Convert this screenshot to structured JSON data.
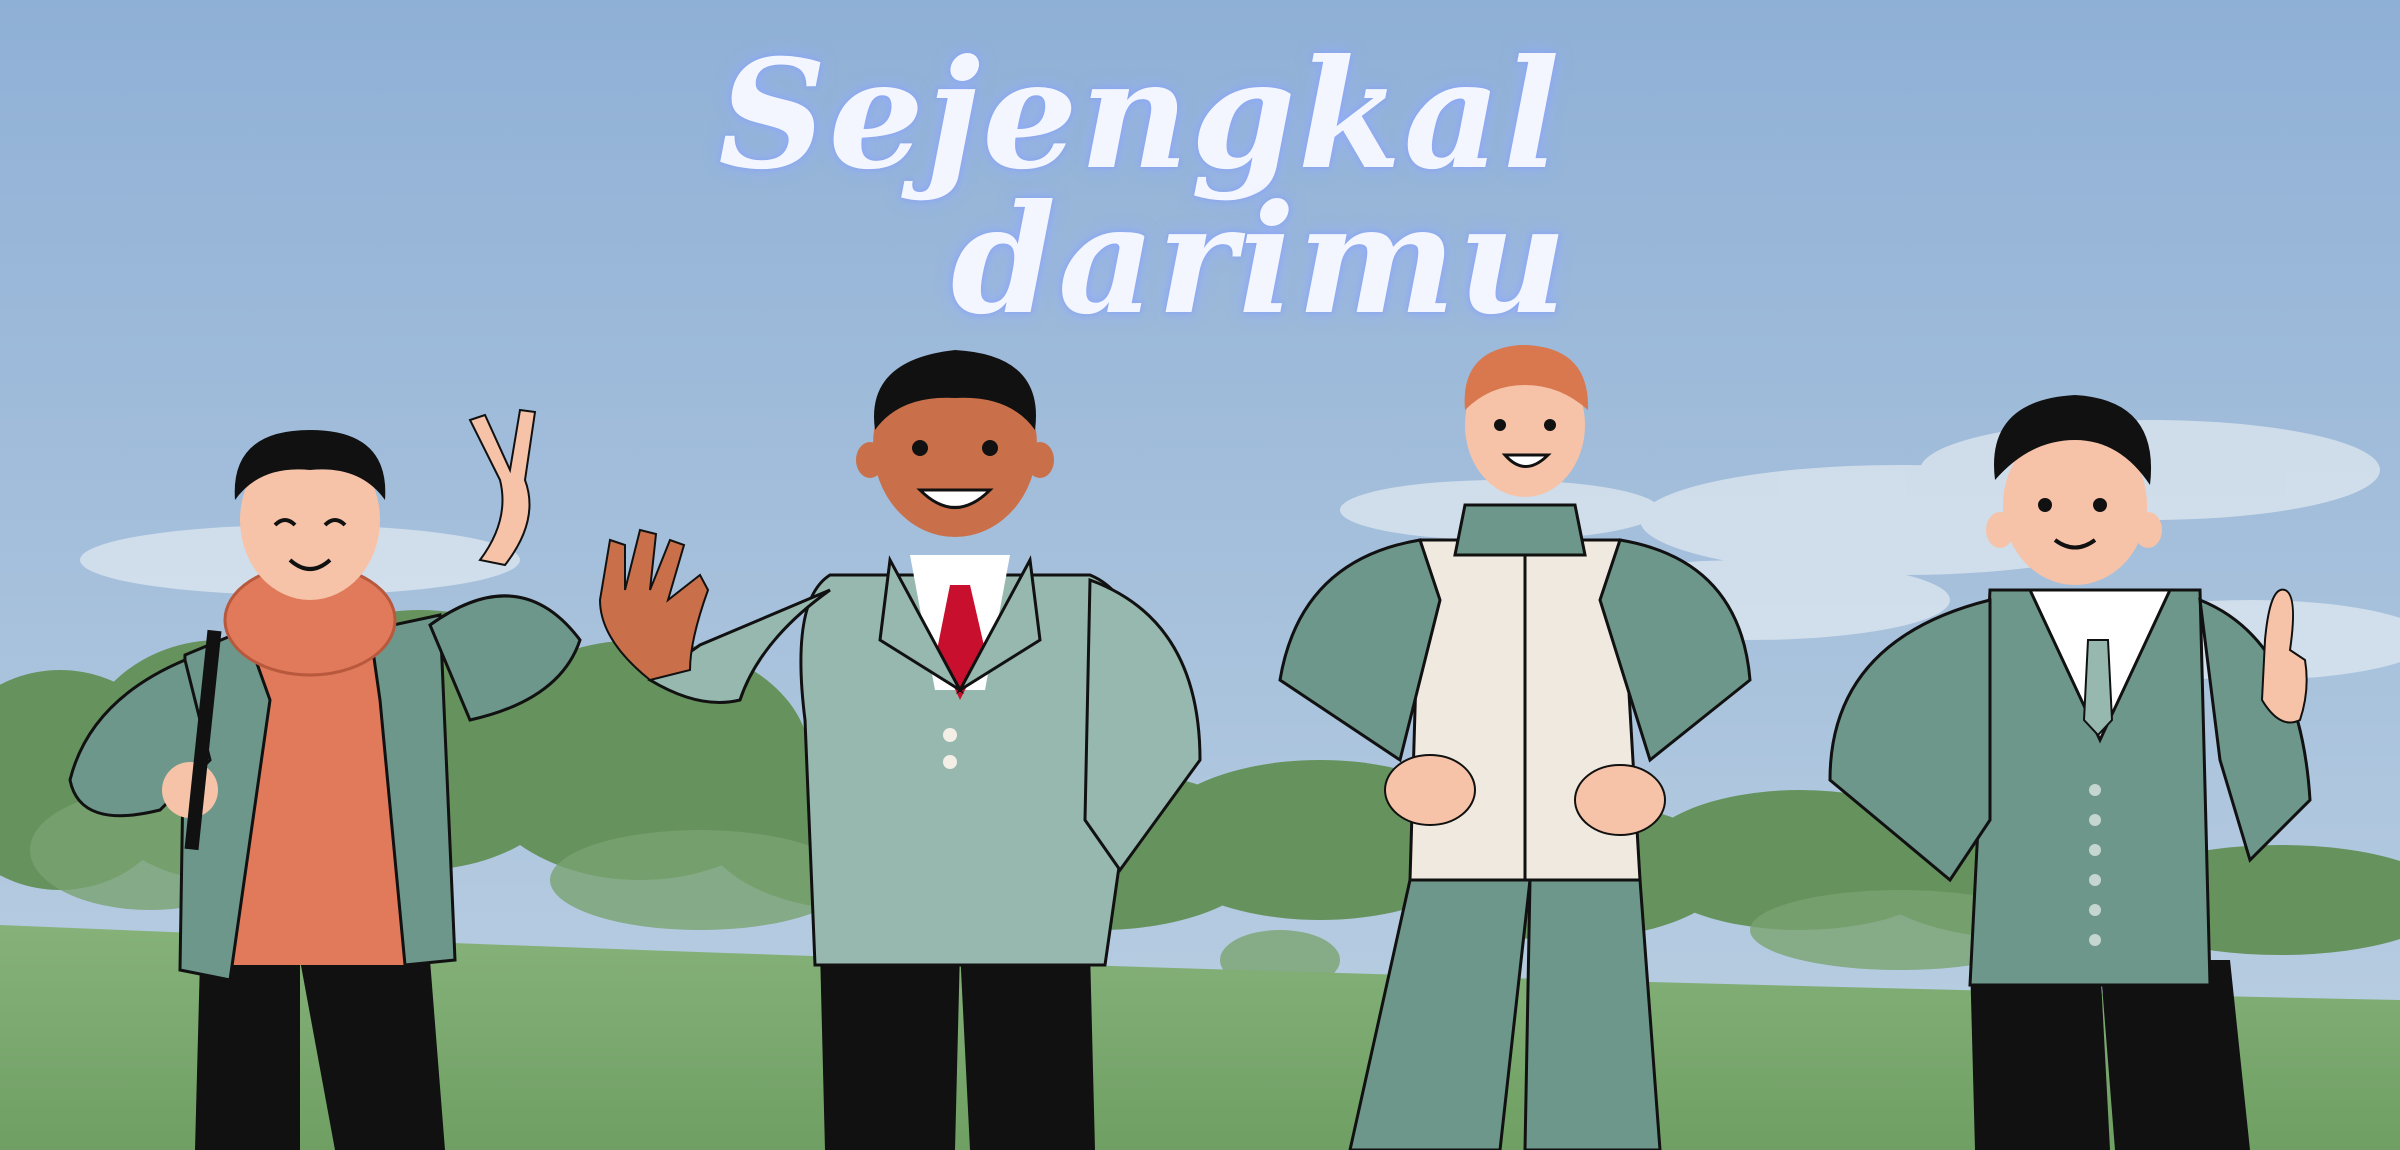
{
  "banner": {
    "title_line1": "Sejengkal",
    "title_line2": "darimu"
  },
  "scene": {
    "sky_top": "#8fb0d6",
    "sky_bottom": "#b9cde0",
    "grass": "#7fae73",
    "trees": "#5f8f5b",
    "teal_jacket": "#6e978b",
    "light_jacket": "#97b8ae",
    "orange_sweater": "#e07a5a",
    "red_tie": "#c8102e",
    "skin_light": "#f6c3a8",
    "skin_dark": "#c9704a",
    "hair_ginger": "#d9774e"
  },
  "figures": [
    {
      "id": "boy-peace-sign"
    },
    {
      "id": "boy-waving"
    },
    {
      "id": "boy-tracksuit"
    },
    {
      "id": "boy-thumbs-up"
    }
  ]
}
